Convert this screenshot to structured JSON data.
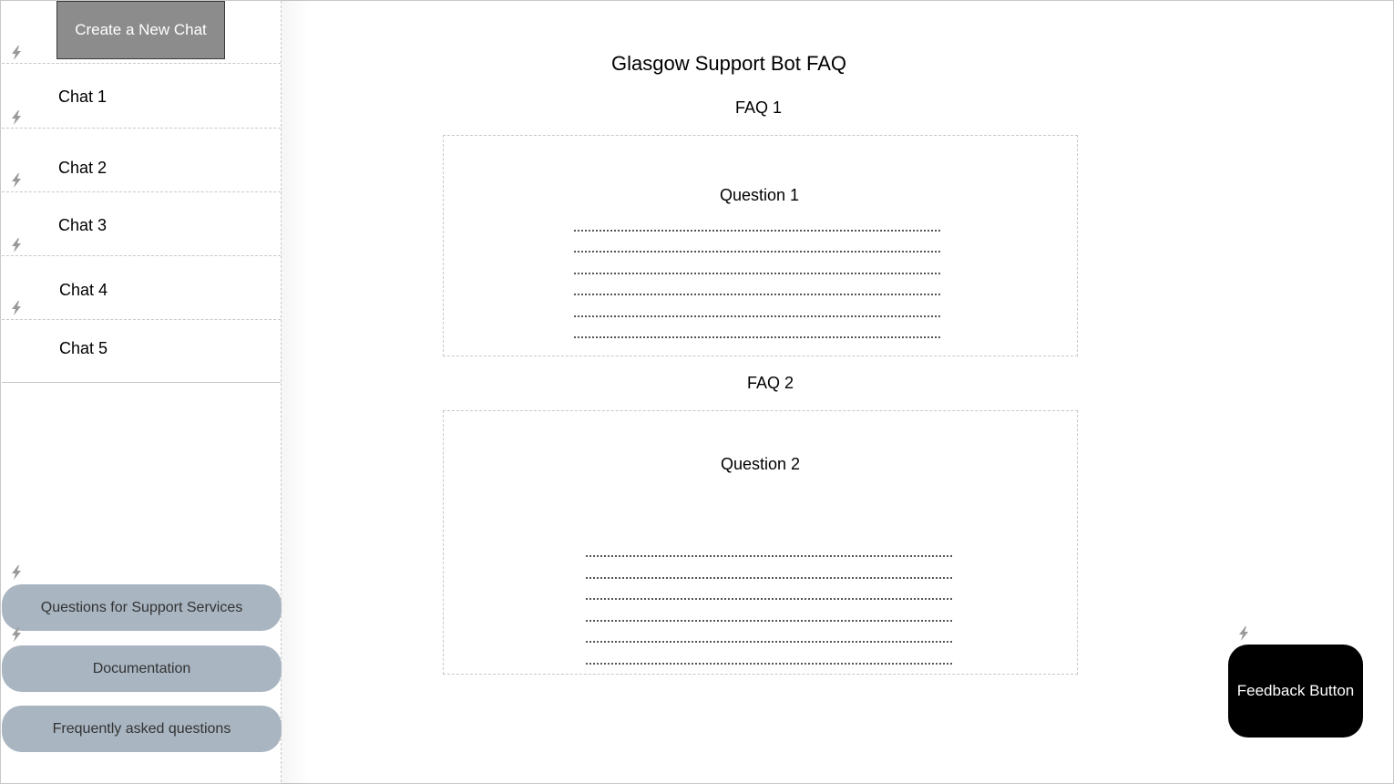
{
  "sidebar": {
    "new_chat_label": "Create a New Chat",
    "chats": [
      {
        "label": "Chat 1"
      },
      {
        "label": "Chat 2"
      },
      {
        "label": "Chat 3"
      },
      {
        "label": "Chat 4"
      },
      {
        "label": "Chat 5"
      }
    ],
    "links": [
      {
        "label": "Questions for Support Services"
      },
      {
        "label": "Documentation"
      },
      {
        "label": "Frequently asked questions"
      }
    ]
  },
  "main": {
    "title": "Glasgow Support Bot FAQ",
    "faqs": [
      {
        "heading": "FAQ 1",
        "question": "Question 1"
      },
      {
        "heading": "FAQ 2",
        "question": "Question 2"
      }
    ]
  },
  "feedback_label": "Feedback Button",
  "icons": {
    "bolt": "lightning-bolt-icon"
  },
  "colors": {
    "new_chat_bg": "#8c8c8c",
    "pill_bg": "#a9b5c1",
    "feedback_bg": "#000000"
  }
}
